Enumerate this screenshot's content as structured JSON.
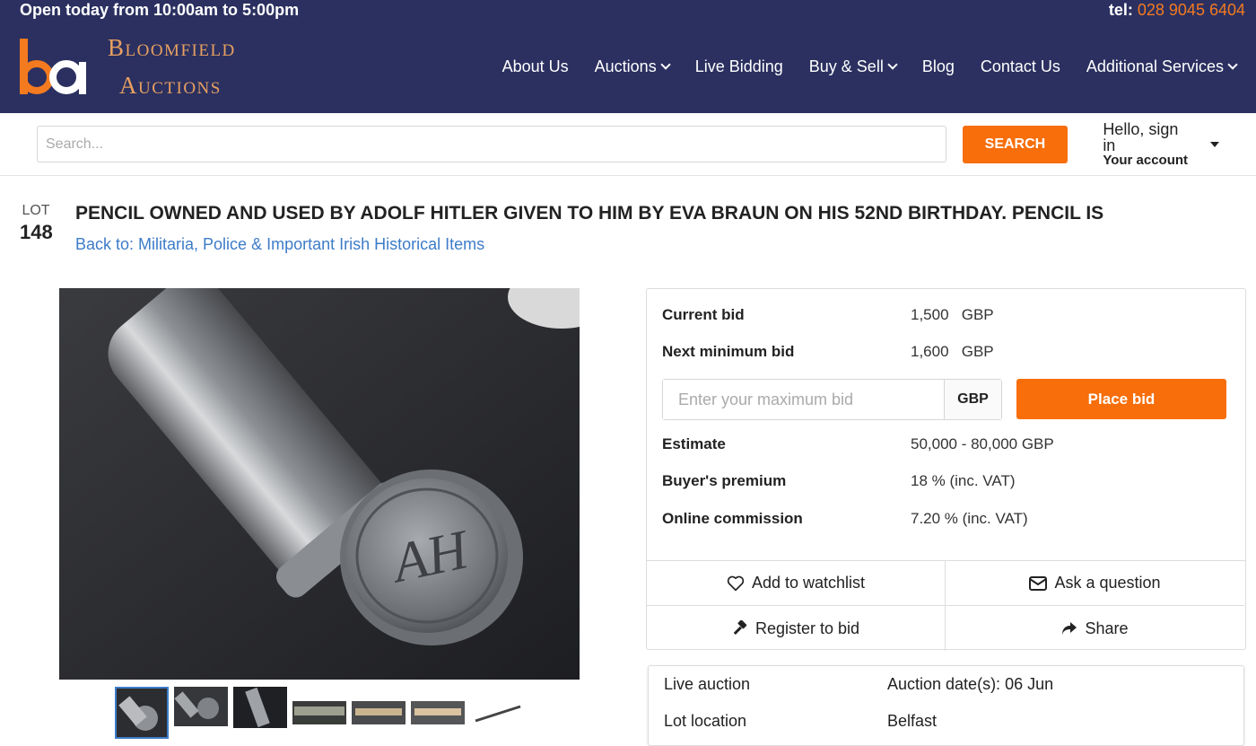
{
  "topbar": {
    "hours": "Open today from 10:00am to 5:00pm",
    "tel_label": "tel:",
    "tel_number": "028 9045 6404"
  },
  "brand": {
    "line1": "Bloomfield",
    "line2": "Auctions",
    "logo_letters": "ba"
  },
  "nav": [
    {
      "label": "About Us",
      "dropdown": false
    },
    {
      "label": "Auctions",
      "dropdown": true
    },
    {
      "label": "Live Bidding",
      "dropdown": false
    },
    {
      "label": "Buy & Sell",
      "dropdown": true
    },
    {
      "label": "Blog",
      "dropdown": false
    },
    {
      "label": "Contact Us",
      "dropdown": false
    },
    {
      "label": "Additional Services",
      "dropdown": true
    }
  ],
  "search": {
    "placeholder": "Search...",
    "button": "SEARCH"
  },
  "account": {
    "hello": "Hello, sign in",
    "label": "Your account"
  },
  "lot": {
    "lot_label": "LOT",
    "lot_number": "148",
    "title": "PENCIL OWNED AND USED BY ADOLF HITLER GIVEN TO HIM BY EVA BRAUN ON HIS 52ND BIRTHDAY. PENCIL IS",
    "back_link": "Back to: Militaria, Police & Important Irish Historical Items"
  },
  "image": {
    "engraving": "AH"
  },
  "bid": {
    "current_label": "Current bid",
    "current_value": "1,500",
    "current_currency": "GBP",
    "next_label": "Next minimum bid",
    "next_value": "1,600",
    "next_currency": "GBP",
    "input_placeholder": "Enter your maximum bid",
    "input_currency": "GBP",
    "place_button": "Place bid",
    "estimate_label": "Estimate",
    "estimate_value": "50,000 - 80,000 GBP",
    "premium_label": "Buyer's premium",
    "premium_value": "18 % (inc. VAT)",
    "commission_label": "Online commission",
    "commission_value": "7.20 % (inc. VAT)"
  },
  "actions": {
    "watchlist": "Add to watchlist",
    "ask": "Ask a question",
    "register": "Register to bid",
    "share": "Share"
  },
  "info": {
    "auction_type": "Live auction",
    "dates": "Auction date(s): 06 Jun",
    "location_label": "Lot location",
    "location_value": "Belfast"
  },
  "colors": {
    "navy": "#2b3060",
    "orange": "#f76e0b",
    "link": "#3d7cc9",
    "brand_gold": "#e8a060"
  }
}
